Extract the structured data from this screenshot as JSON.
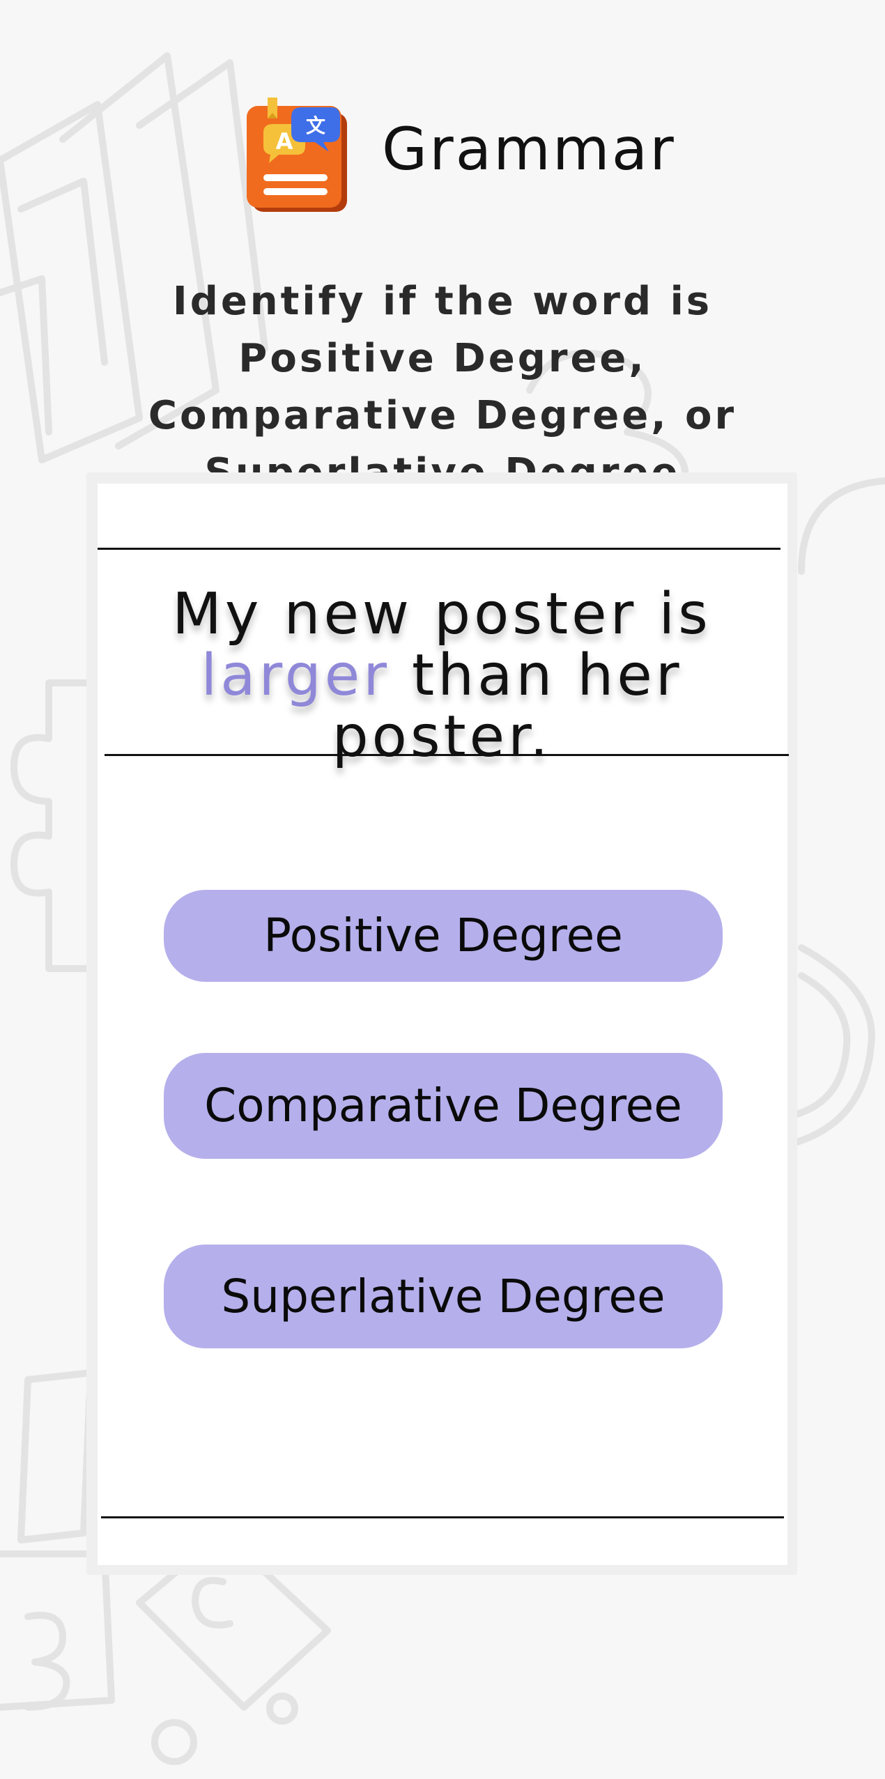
{
  "header": {
    "title": "Grammar",
    "icon": "grammar-book-icon"
  },
  "instruction": "Identify if the word is Positive Degree, Comparative Degree, or Superlative Degree",
  "question": {
    "before": "My new poster is",
    "highlight": "larger",
    "after": " than her poster."
  },
  "options": [
    {
      "label": "Positive Degree"
    },
    {
      "label": "Comparative Degree"
    },
    {
      "label": "Superlative Degree"
    }
  ],
  "colors": {
    "background": "#f7f7f7",
    "card": "#ffffff",
    "option_fill": "#b5b0eb",
    "highlight_text": "#8f88d8",
    "icon_orange": "#f06b1e",
    "icon_blue": "#3f6fe8",
    "icon_yellow": "#f5c13a"
  }
}
